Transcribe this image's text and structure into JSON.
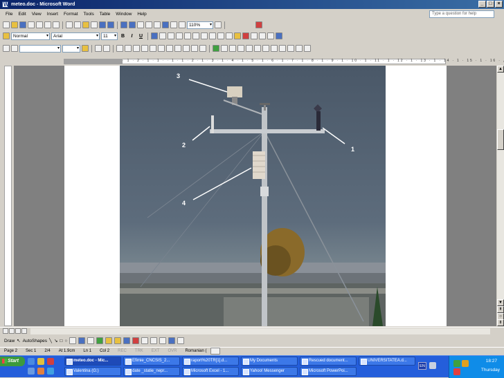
{
  "window": {
    "title": "meteo.doc - Microsoft Word"
  },
  "menu": {
    "items": [
      "File",
      "Edit",
      "View",
      "Insert",
      "Format",
      "Tools",
      "Table",
      "Window",
      "Help"
    ],
    "help_placeholder": "Type a question for help"
  },
  "standard_toolbar": {
    "zoom": "110%"
  },
  "formatting_toolbar": {
    "style": "Normal",
    "font": "Arial",
    "size": "11"
  },
  "drawing_toolbar": {
    "draw_label": "Draw",
    "autoshapes_label": "AutoShapes"
  },
  "figure": {
    "labels": [
      "1",
      "2",
      "3",
      "4"
    ]
  },
  "ruler": {
    "numbers": "· 1 · 2 · 1 · 1 ·    · 1 · 1 · 2 · 1 · 3 · 1 · 4 · 1 · 5 · 1 · 6 · 1 · 7 · 1 · 8 · 1 · 9 · 1 · 10 · 1 · 11 · 1 · 12 · 1 · 13 · 1 · 14 · 1 · 15 · 1 · 16 · △ 17 ·"
  },
  "status": {
    "page": "Page 2",
    "section": "Sec 1",
    "pages": "2/4",
    "at": "At 1.9cm",
    "line": "Ln 1",
    "col": "Col 2",
    "rec": "REC",
    "trk": "TRK",
    "ext": "EXT",
    "ovr": "OVR",
    "language": "Romanian ("
  },
  "taskbar": {
    "start": "Start",
    "tasks_row1": [
      "meteo.doc - Mic...",
      "Efimie_CNCSIS_2...",
      "raport%20TR[1].d...",
      "My Documents",
      "Rescued document...",
      "UNIVERSITATEA.d..."
    ],
    "tasks_row2": [
      "Valentina (G:)",
      "date _statie_nepr...",
      "Microsoft Excel - 1...",
      "Yahoo! Messenger",
      "Microsoft PowerPoi..."
    ],
    "lang": "EN",
    "clock": "18:27",
    "day": "Thursday"
  }
}
